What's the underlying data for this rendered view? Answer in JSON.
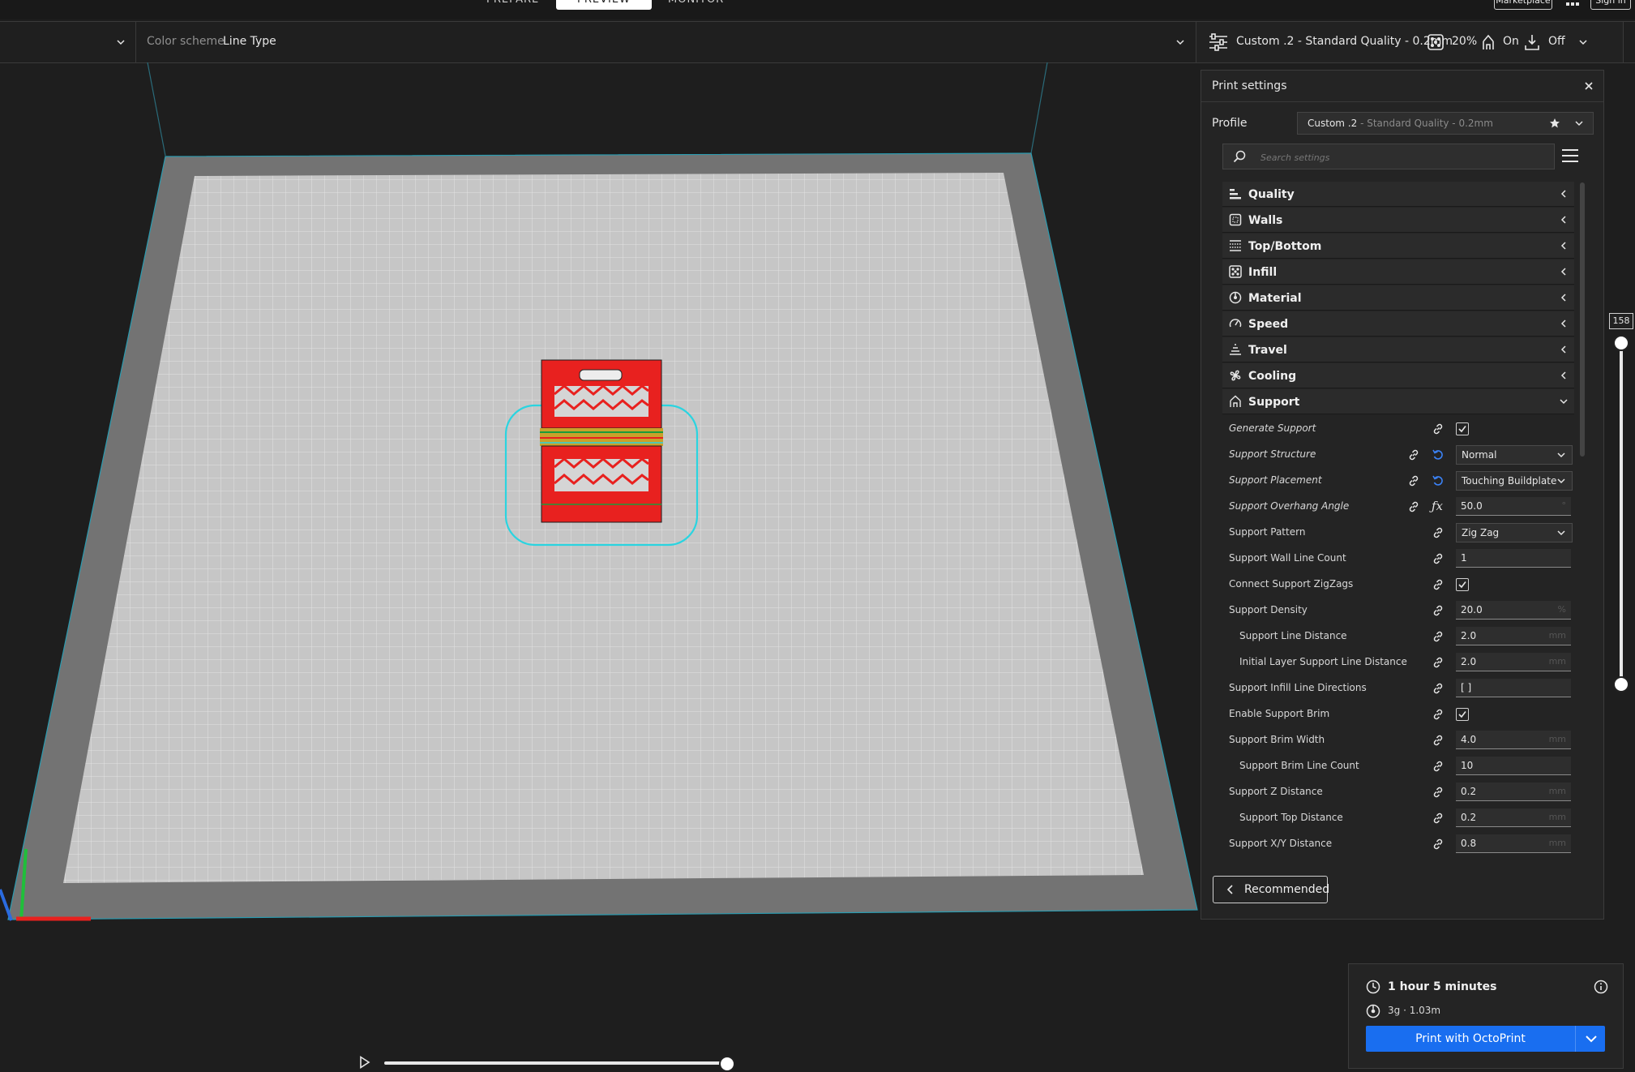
{
  "stages": [
    {
      "label": "PREPARE",
      "active": false
    },
    {
      "label": "PREVIEW",
      "active": true
    },
    {
      "label": "MONITOR",
      "active": false
    }
  ],
  "header_buttons": {
    "marketplace": "Marketplace",
    "sign_in": "Sign in"
  },
  "view_toolbar": {
    "color_scheme_label": "Color scheme",
    "color_scheme_value": "Line Type"
  },
  "print_summary": {
    "profile": "Custom .2 - Standard Quality - 0.2mm",
    "infill": "20%",
    "support": "On",
    "adhesion": "Off"
  },
  "panel": {
    "title": "Print settings",
    "close_icon": "close-icon",
    "profile_label": "Profile",
    "profile_name": "Custom .2",
    "profile_detail": " - Standard Quality - 0.2mm",
    "search_placeholder": "Search settings",
    "categories": [
      {
        "label": "Quality",
        "icon": "quality-icon",
        "expanded": false
      },
      {
        "label": "Walls",
        "icon": "walls-icon",
        "expanded": false
      },
      {
        "label": "Top/Bottom",
        "icon": "topbottom-icon",
        "expanded": false
      },
      {
        "label": "Infill",
        "icon": "infill-icon",
        "expanded": false
      },
      {
        "label": "Material",
        "icon": "material-icon",
        "expanded": false
      },
      {
        "label": "Speed",
        "icon": "speed-icon",
        "expanded": false
      },
      {
        "label": "Travel",
        "icon": "travel-icon",
        "expanded": false
      },
      {
        "label": "Cooling",
        "icon": "cooling-icon",
        "expanded": false
      },
      {
        "label": "Support",
        "icon": "support-icon",
        "expanded": true
      }
    ],
    "support_settings": [
      {
        "label": "Generate Support",
        "type": "checkbox",
        "checked": true,
        "italic": true
      },
      {
        "label": "Support Structure",
        "type": "select",
        "value": "Normal",
        "italic": true,
        "reset": true
      },
      {
        "label": "Support Placement",
        "type": "select",
        "value": "Touching Buildplate",
        "italic": true,
        "reset": true
      },
      {
        "label": "Support Overhang Angle",
        "type": "field",
        "value": "50.0",
        "unit": "°",
        "italic": true,
        "fx": true
      },
      {
        "label": "Support Pattern",
        "type": "select",
        "value": "Zig Zag"
      },
      {
        "label": "Support Wall Line Count",
        "type": "field",
        "value": "1",
        "unit": ""
      },
      {
        "label": "Connect Support ZigZags",
        "type": "checkbox",
        "checked": true
      },
      {
        "label": "Support Density",
        "type": "field",
        "value": "20.0",
        "unit": "%"
      },
      {
        "label": "Support Line Distance",
        "type": "field",
        "value": "2.0",
        "unit": "mm",
        "indent": true
      },
      {
        "label": "Initial Layer Support Line Distance",
        "type": "field",
        "value": "2.0",
        "unit": "mm",
        "indent": true
      },
      {
        "label": "Support Infill Line Directions",
        "type": "field",
        "value": "[ ]",
        "unit": ""
      },
      {
        "label": "Enable Support Brim",
        "type": "checkbox",
        "checked": true
      },
      {
        "label": "Support Brim Width",
        "type": "field",
        "value": "4.0",
        "unit": "mm"
      },
      {
        "label": "Support Brim Line Count",
        "type": "field",
        "value": "10",
        "unit": "",
        "indent": true
      },
      {
        "label": "Support Z Distance",
        "type": "field",
        "value": "0.2",
        "unit": "mm"
      },
      {
        "label": "Support Top Distance",
        "type": "field",
        "value": "0.2",
        "unit": "mm",
        "indent": true
      },
      {
        "label": "Support X/Y Distance",
        "type": "field",
        "value": "0.8",
        "unit": "mm"
      }
    ],
    "recommended_label": "Recommended"
  },
  "layer_slider": {
    "current_layer": "158"
  },
  "print_card": {
    "time": "1 hour 5 minutes",
    "material": "3g · 1.03m",
    "print_button": "Print with OctoPrint"
  },
  "colors": {
    "accent": "#196ef0",
    "model": "#e8211f",
    "skirt": "#2ad4e0",
    "plate": "#bfbfbf"
  }
}
